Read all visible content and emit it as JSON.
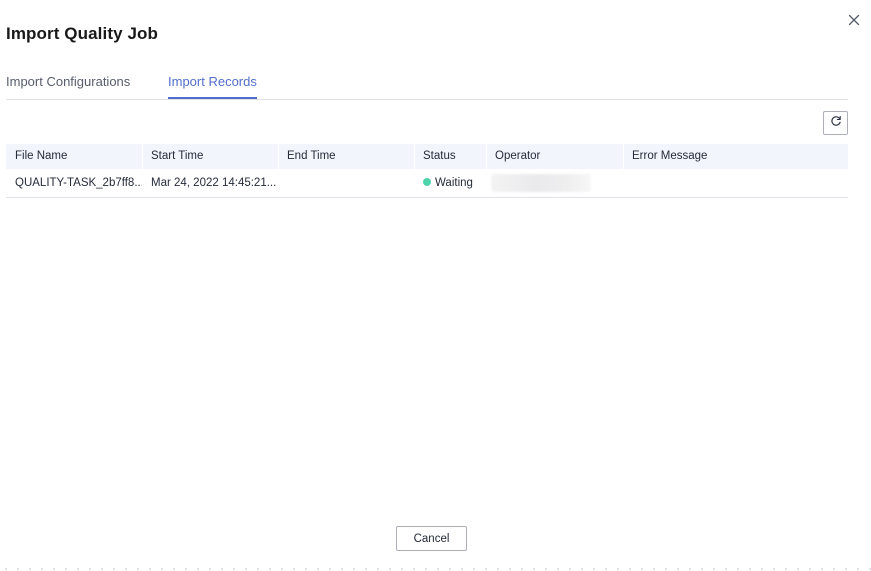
{
  "dialog": {
    "title": "Import Quality Job",
    "close_icon": "close-icon"
  },
  "tabs": [
    {
      "label": "Import Configurations",
      "active": false
    },
    {
      "label": "Import Records",
      "active": true
    }
  ],
  "toolbar": {
    "refresh_icon": "refresh-icon"
  },
  "table": {
    "columns": [
      "File Name",
      "Start Time",
      "End Time",
      "Status",
      "Operator",
      "Error Message"
    ],
    "rows": [
      {
        "file_name": "QUALITY-TASK_2b7ff8...",
        "start_time": "Mar 24, 2022 14:45:21...",
        "end_time": "",
        "status": "Waiting",
        "operator": "",
        "error_message": ""
      }
    ]
  },
  "footer": {
    "cancel_label": "Cancel"
  },
  "colors": {
    "accent": "#526ecc",
    "status_waiting": "#50d4ab",
    "header_bg": "#f2f5fc",
    "border": "#dfe1e6"
  }
}
